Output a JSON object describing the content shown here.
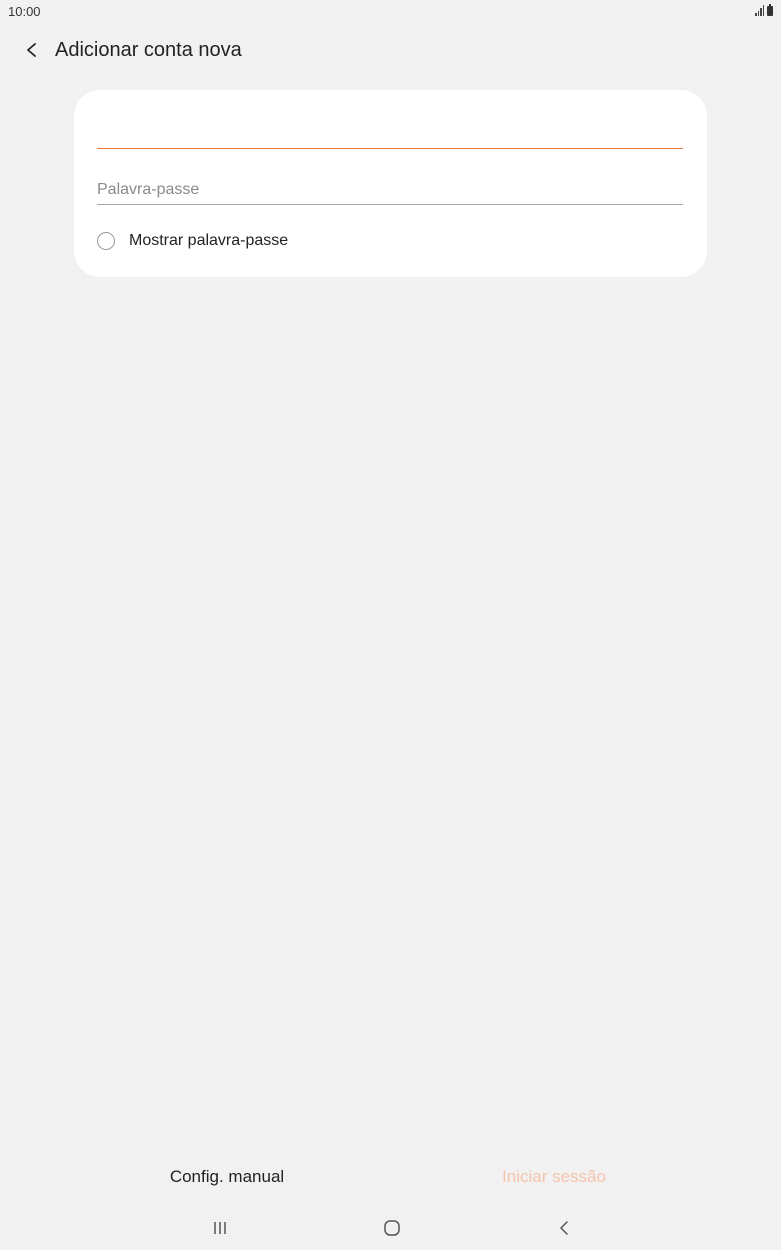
{
  "status_bar": {
    "time": "10:00",
    "icons": [
      "signal-icon",
      "battery-icon"
    ]
  },
  "header": {
    "back_icon": "chevron-left-icon",
    "title": "Adicionar conta nova"
  },
  "form": {
    "email": {
      "value": "",
      "placeholder": "",
      "focused": true
    },
    "password": {
      "value": "",
      "placeholder": "Palavra-passe"
    },
    "show_password": {
      "label": "Mostrar palavra-passe",
      "checked": false
    }
  },
  "actions": {
    "manual_setup_label": "Config. manual",
    "sign_in_label": "Iniciar sessão",
    "sign_in_enabled": false
  },
  "nav_bar": {
    "items": [
      "recent-apps-icon",
      "home-icon",
      "back-icon"
    ]
  },
  "colors": {
    "background": "#f1f1f1",
    "card": "#ffffff",
    "accent": "#e8773f",
    "disabled_accent": "#f6c3ad"
  }
}
